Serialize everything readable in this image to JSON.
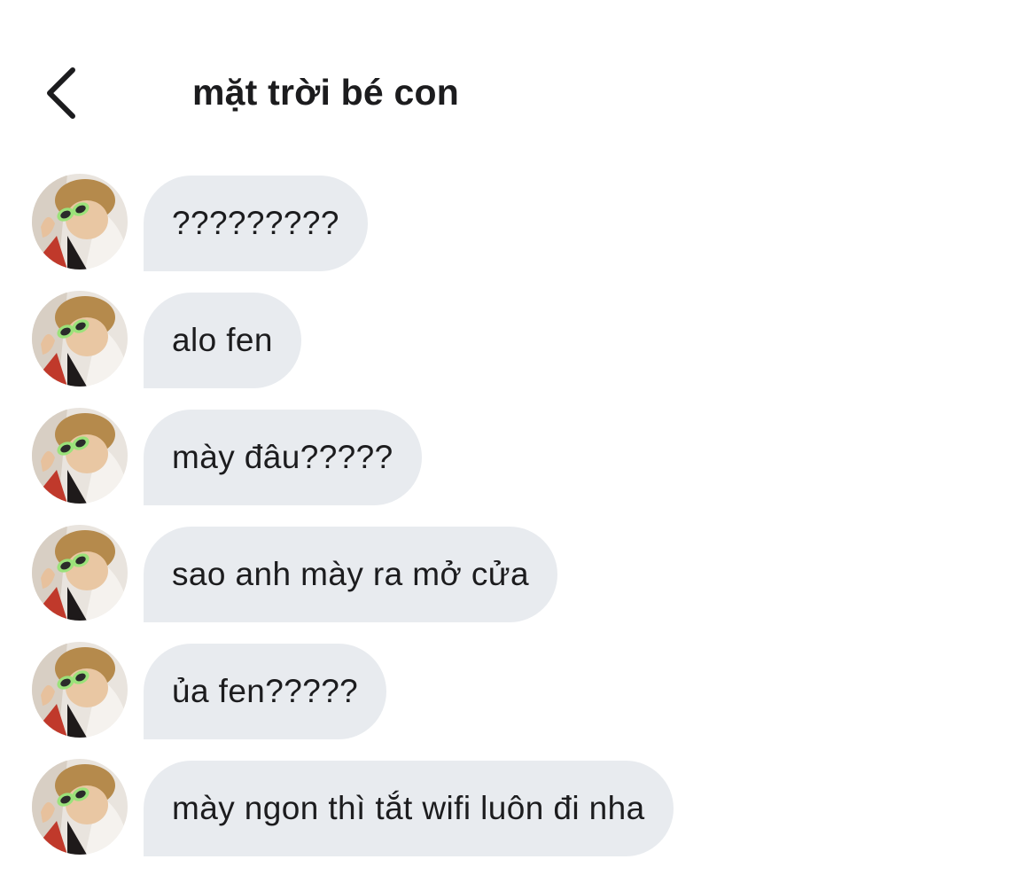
{
  "header": {
    "back_icon": "chevron-left-icon",
    "title": "mặt trời bé con"
  },
  "messages": [
    {
      "text": "?????????"
    },
    {
      "text": "alo fen"
    },
    {
      "text": "mày đâu?????"
    },
    {
      "text": "sao anh mày ra mở cửa"
    },
    {
      "text": "ủa fen?????"
    },
    {
      "text": "mày ngon thì tắt wifi luôn đi nha"
    }
  ],
  "colors": {
    "bubble_background": "#e8ebef",
    "text": "#1c1c1e",
    "background": "#ffffff"
  }
}
